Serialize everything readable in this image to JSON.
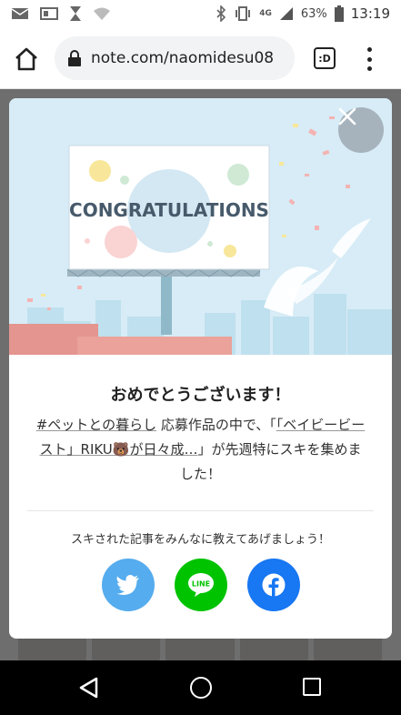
{
  "status_bar": {
    "battery_pct": "63%",
    "time": "13:19",
    "network": "4G"
  },
  "browser": {
    "url": "note.com/naomidesu08",
    "tabs_icon_label": ":D"
  },
  "modal": {
    "banner_text": "CONGRATULATIONS",
    "title": "おめでとうございます！",
    "hashtag": "#ペットとの暮らし",
    "desc_part1": " 応募作品の中で、「",
    "article_title": "「ベイビービースト」RIKU🐻が日々成…",
    "desc_part2": "」が先週特にスキを集めました！",
    "share_prompt": "スキされた記事をみんなに教えてあげましょう！",
    "share_buttons": [
      {
        "icon": "twitter-icon",
        "color": "#55acee"
      },
      {
        "icon": "line-icon",
        "color": "#00c300",
        "label": "LINE"
      },
      {
        "icon": "facebook-icon",
        "color": "#1877f2"
      }
    ]
  },
  "colors": {
    "hero_bg": "#d7ecf6",
    "overlay": "rgba(0,0,0,0.55)"
  }
}
